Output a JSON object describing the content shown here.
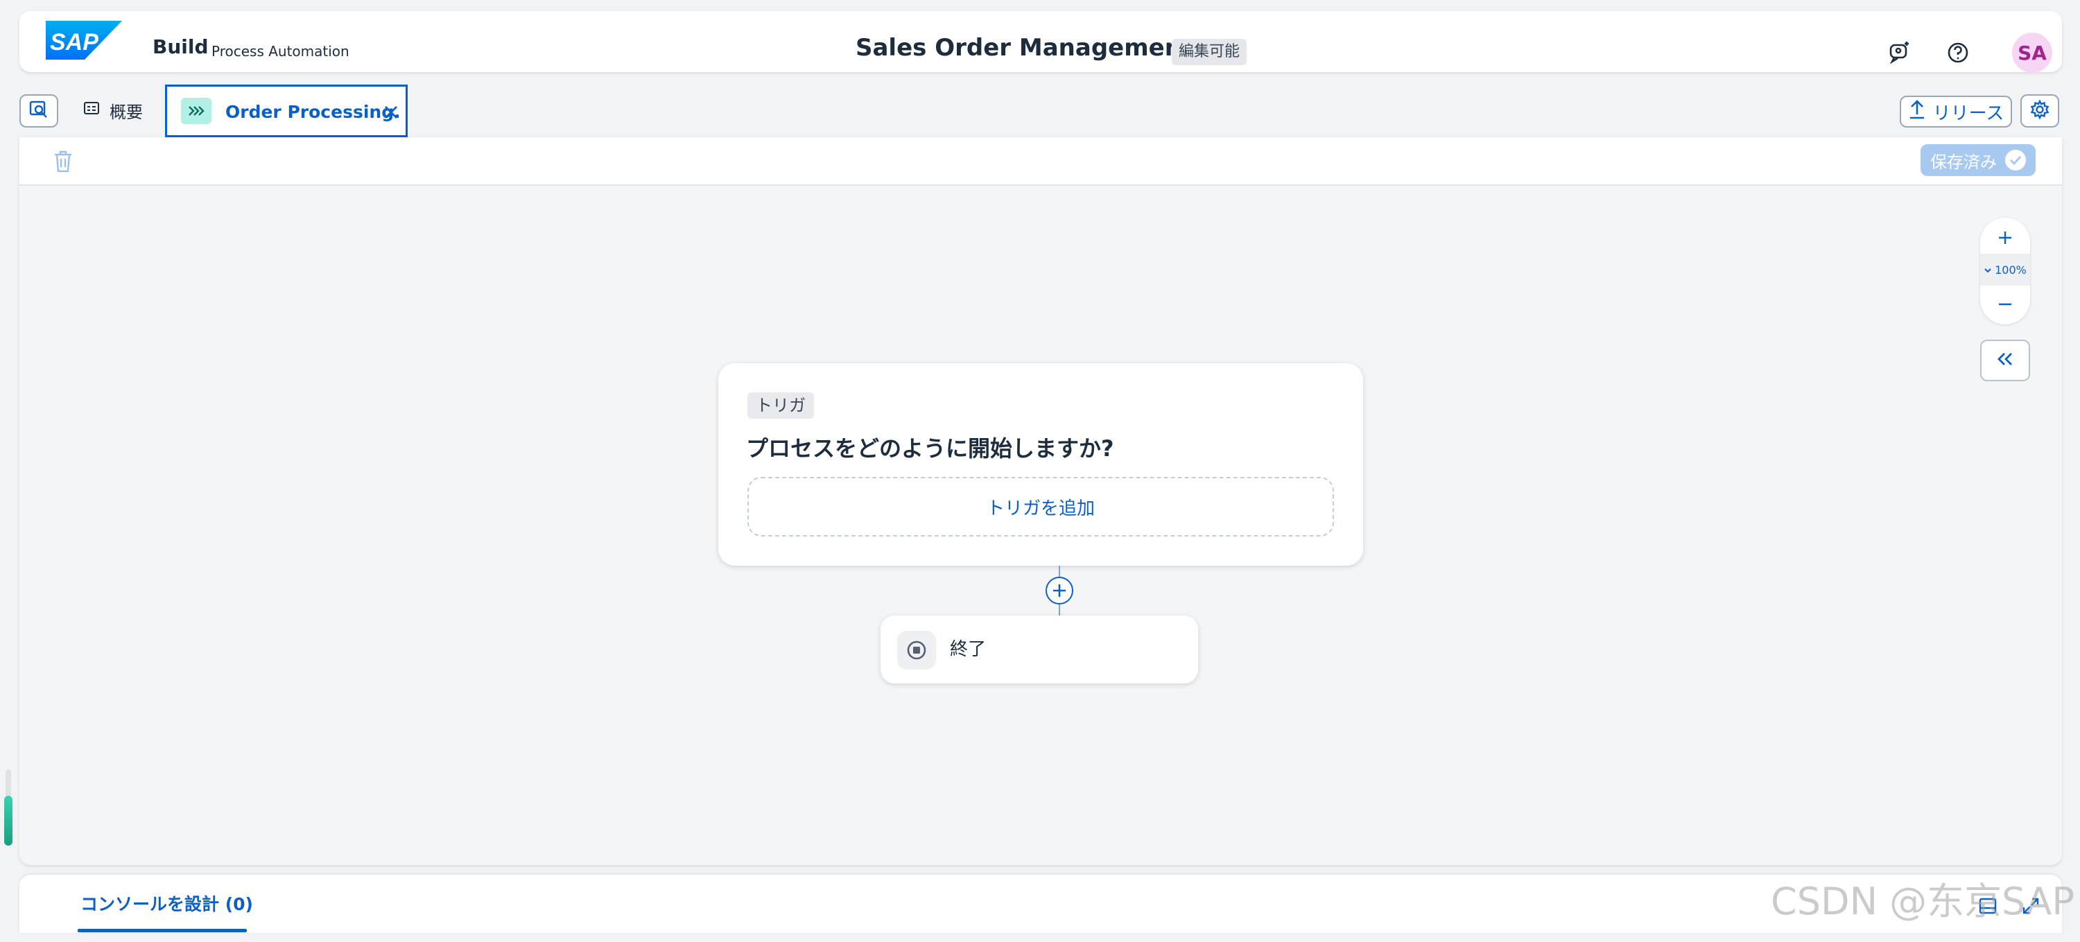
{
  "shell": {
    "logo_text": "SAP",
    "product": "Build",
    "product_sub": "Process Automation",
    "title": "Sales Order Management.",
    "badge": "編集可能",
    "avatar": "SA"
  },
  "tabs": {
    "overview_label": "概要",
    "active_label": "Order Processing.",
    "release_label": "リリース"
  },
  "toolbar": {
    "saved_label": "保存済み"
  },
  "zoom": {
    "level": "100%"
  },
  "flow": {
    "trigger_tag": "トリガ",
    "trigger_question": "プロセスをどのように開始しますか?",
    "add_trigger": "トリガを追加",
    "end_label": "終了"
  },
  "console": {
    "tab_label": "コンソールを設計 (0)"
  },
  "watermark": "CSDN @东京SAP",
  "colors": {
    "accent": "#0b60c7",
    "brand": "#0070f2",
    "avatar_bg": "#f6d6f2",
    "avatar_fg": "#a2238e",
    "saved_bg": "#a8c9f0",
    "tab_glyph_bg": "#b2f0e5"
  },
  "icons": {
    "shell": [
      "chat-bot-icon",
      "help-icon"
    ],
    "tabs": [
      "search-canvas-icon",
      "overview-icon",
      "process-chevrons-icon",
      "close-icon",
      "upload-icon",
      "settings-icon"
    ],
    "toolbar": [
      "trash-icon",
      "check-circle-icon"
    ],
    "zoom": [
      "zoom-in-icon",
      "chevron-down-icon",
      "zoom-out-icon",
      "double-chevron-left-icon"
    ],
    "flow": [
      "add-step-icon",
      "stop-icon"
    ],
    "console": [
      "panel-icon",
      "expand-icon"
    ]
  }
}
